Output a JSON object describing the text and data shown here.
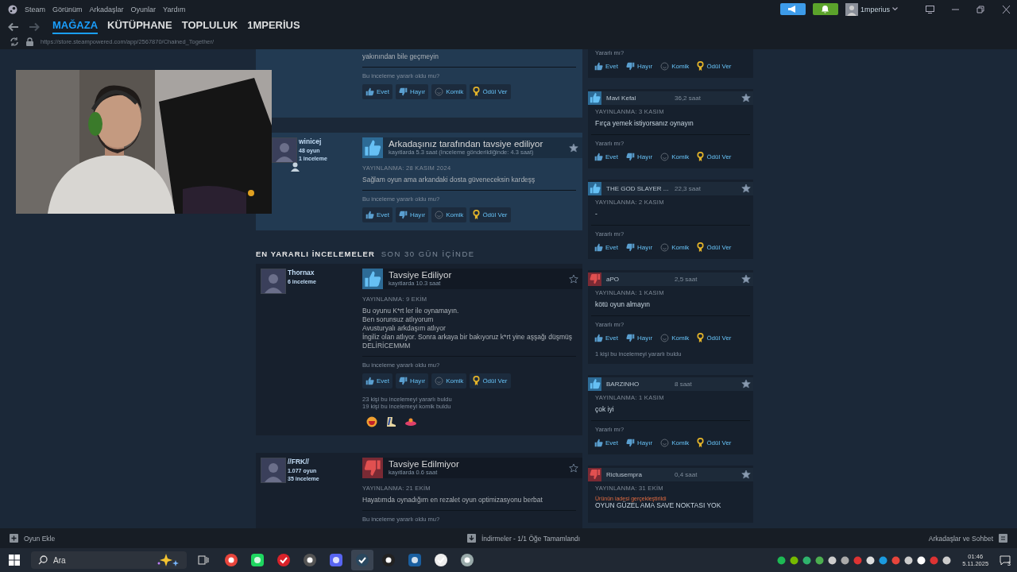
{
  "titlebar": {
    "menu": [
      "Steam",
      "Görünüm",
      "Arkadaşlar",
      "Oyunlar",
      "Yardım"
    ],
    "user": "1mperius"
  },
  "nav": {
    "tabs": [
      {
        "label": "MAĞAZA",
        "selected": true
      },
      {
        "label": "KÜTÜPHANE",
        "selected": false
      },
      {
        "label": "TOPLULUK",
        "selected": false
      },
      {
        "label": "1MPERİUS",
        "selected": false
      }
    ],
    "url": "https://store.steampowered.com/app/2567870/Chained_Together/"
  },
  "left_reviews": [
    {
      "friend": true,
      "text": [
        "yakınından bile geçmeyin"
      ],
      "helpful_prompt": "Bu inceleme yararlı oldu mu?",
      "buttons": [
        "Evet",
        "Hayır",
        "Komik",
        "Ödül Ver"
      ]
    },
    {
      "friend": true,
      "author": "winicej",
      "games": "48 oyun",
      "reviews": "1 inceleme",
      "recommended": true,
      "verdict": "Arkadaşınız tarafından tavsiye ediliyor",
      "hours": "kayıtlarda 5.3 saat (İnceleme gönderildiğinde: 4.3 saat)",
      "posted": "YAYINLANMA: 28 KASIM 2024",
      "text": [
        "Sağlam oyun ama arkandaki dosta güveneceksin kardeşş"
      ],
      "helpful_prompt": "Bu inceleme yararlı oldu mu?",
      "buttons": [
        "Evet",
        "Hayır",
        "Komik",
        "Ödül Ver"
      ]
    }
  ],
  "section": {
    "title": "EN YARARLI İNCELEMELER",
    "subtitle": "SON 30 GÜN İÇİNDE"
  },
  "helpful_reviews": [
    {
      "friend": false,
      "author": "Thornax",
      "reviews": "6 inceleme",
      "recommended": true,
      "verdict": "Tavsiye Ediliyor",
      "hours": "kayıtlarda 10.3 saat",
      "posted": "YAYINLANMA: 9 EKİM",
      "text": [
        "Bu oyunu K*rt ler ile oynamayın.",
        "Ben sorunsuz atlıyorum",
        "Avusturyalı arkdaşım atlıyor",
        "İngiliz olan atlıyor. Sonra arkaya bir bakıyoruz k*rt yine aşşağı düşmüş",
        "DELİRİCEMMM"
      ],
      "helpful_prompt": "Bu inceleme yararlı oldu mu?",
      "buttons": [
        "Evet",
        "Hayır",
        "Komik",
        "Ödül Ver"
      ],
      "stats": [
        "23 kişi bu incelemeyi yararlı buldu",
        "19 kişi bu incelemeyi komik buldu"
      ],
      "awards": true
    },
    {
      "friend": false,
      "author": "//FRK//",
      "games": "1.077 oyun",
      "reviews": "35 inceleme",
      "recommended": false,
      "verdict": "Tavsiye Edilmiyor",
      "hours": "kayıtlarda 0.6 saat",
      "posted": "YAYINLANMA: 21 EKİM",
      "text": [
        "Hayatımda oynadığım en rezalet oyun optimizasyonu berbat"
      ],
      "helpful_prompt": "Bu inceleme yararlı oldu mu?"
    }
  ],
  "right_reviews": [
    {
      "helpful_prompt": "Yararlı mı?",
      "buttons": [
        "Evet",
        "Hayır",
        "Komik",
        "Ödül Ver"
      ]
    },
    {
      "author": "Mavi Kefal",
      "hours": "36,2 saat",
      "recommended": true,
      "posted": "YAYINLANMA: 3 KASIM",
      "text": "Fırça yemek istiyorsanız oynayın",
      "helpful_prompt": "Yararlı mı?",
      "buttons": [
        "Evet",
        "Hayır",
        "Komik",
        "Ödül Ver"
      ]
    },
    {
      "author": "THE GOD SLAYER ...",
      "hours": "22,3 saat",
      "recommended": true,
      "posted": "YAYINLANMA: 2 KASIM",
      "text": "-",
      "helpful_prompt": "Yararlı mı?",
      "buttons": [
        "Evet",
        "Hayır",
        "Komik",
        "Ödül Ver"
      ]
    },
    {
      "author": "aPO",
      "hours": "2,5 saat",
      "recommended": false,
      "posted": "YAYINLANMA: 1 KASIM",
      "text": "kötü oyun almayın",
      "helpful_prompt": "Yararlı mı?",
      "buttons": [
        "Evet",
        "Hayır",
        "Komik",
        "Ödül Ver"
      ],
      "stats": [
        "1 kişi bu incelemeyi yararlı buldu"
      ]
    },
    {
      "author": "BARZINHO",
      "hours": "8 saat",
      "recommended": true,
      "posted": "YAYINLANMA: 1 KASIM",
      "text": "çok iyi",
      "helpful_prompt": "Yararlı mı?",
      "buttons": [
        "Evet",
        "Hayır",
        "Komik",
        "Ödül Ver"
      ]
    },
    {
      "author": "Rictusempra",
      "hours": "0,4 saat",
      "recommended": false,
      "posted": "YAYINLANMA: 31 EKİM",
      "refund_note": "Ürünün iadesi gerçekleştirildi",
      "text": "OYUN GÜZEL AMA SAVE NOKTASI YOK"
    }
  ],
  "bottom_bar": {
    "add_game": "Oyun Ekle",
    "downloads": "İndirmeler - 1/1 Öğe Tamamlandı",
    "friends": "Arkadaşlar ve Sohbet"
  },
  "taskbar": {
    "search_placeholder": "Ara",
    "apps": [
      {
        "selected": false
      },
      {
        "selected": false
      },
      {
        "selected": false
      },
      {
        "selected": false
      },
      {
        "selected": false
      },
      {
        "selected": true
      },
      {
        "selected": false
      },
      {
        "selected": false
      },
      {
        "selected": false
      },
      {
        "selected": false
      }
    ],
    "time": "01:46",
    "date": "5.11.2025",
    "notifications": "3"
  }
}
